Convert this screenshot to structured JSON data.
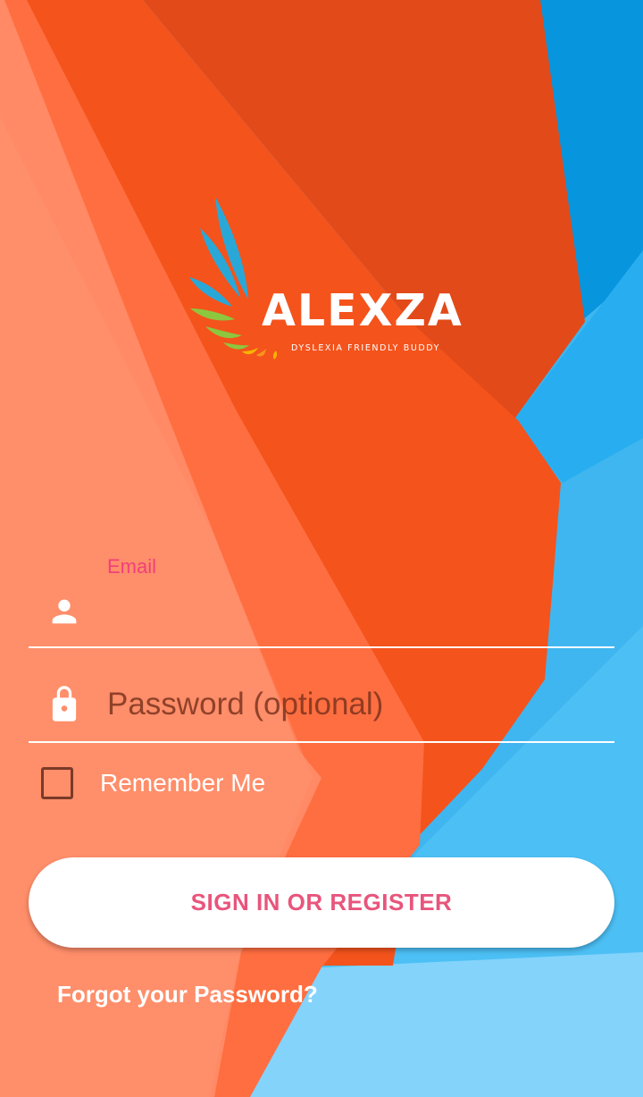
{
  "logo": {
    "wordmark": "ALEXZA",
    "tagline": "DYSLEXIA FRIENDLY BUDDY"
  },
  "form": {
    "email": {
      "label": "Email",
      "value": "",
      "icon": "person-icon"
    },
    "password": {
      "placeholder": "Password (optional)",
      "value": "",
      "icon": "lock-icon"
    },
    "remember_me": {
      "label": "Remember Me",
      "checked": false
    },
    "submit_label": "SIGN IN OR REGISTER",
    "forgot_label": "Forgot your Password?"
  },
  "colors": {
    "accent_pink": "#f0407a",
    "button_text": "#e8557c",
    "orange_primary": "#f5511c",
    "orange_light": "#ff8a65",
    "blue_primary": "#29b0f0",
    "blue_light": "#81d4fa"
  }
}
